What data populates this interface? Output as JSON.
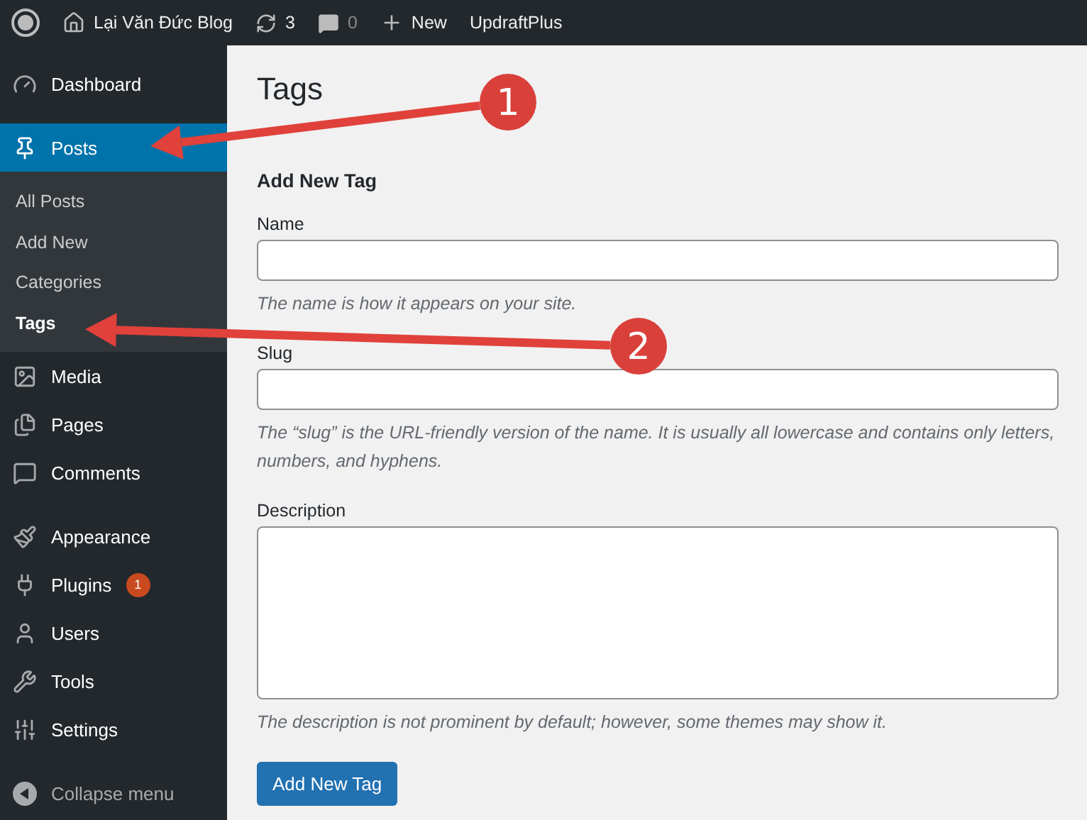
{
  "admin_bar": {
    "site_name": "Lại Văn Đức Blog",
    "updates_count": "3",
    "comments_count": "0",
    "new_label": "New",
    "plugin_link": "UpdraftPlus"
  },
  "sidebar": {
    "groups": [
      {
        "items": [
          {
            "label": "Dashboard",
            "selected": false
          }
        ]
      },
      {
        "items": [
          {
            "label": "Posts",
            "selected": true,
            "submenu": [
              {
                "label": "All Posts",
                "selected": false
              },
              {
                "label": "Add New",
                "selected": false
              },
              {
                "label": "Categories",
                "selected": false
              },
              {
                "label": "Tags",
                "selected": true
              }
            ]
          },
          {
            "label": "Media",
            "selected": false
          },
          {
            "label": "Pages",
            "selected": false
          },
          {
            "label": "Comments",
            "selected": false
          }
        ]
      },
      {
        "items": [
          {
            "label": "Appearance",
            "selected": false
          },
          {
            "label": "Plugins",
            "selected": false,
            "badge": "1"
          },
          {
            "label": "Users",
            "selected": false
          },
          {
            "label": "Tools",
            "selected": false
          },
          {
            "label": "Settings",
            "selected": false
          }
        ]
      }
    ],
    "collapse_label": "Collapse menu"
  },
  "page": {
    "title": "Tags",
    "form_title": "Add New Tag",
    "fields": [
      {
        "kind": "input",
        "label": "Name",
        "help": "The name is how it appears on your site."
      },
      {
        "kind": "input",
        "label": "Slug",
        "help": "The “slug” is the URL-friendly version of the name. It is usually all lowercase and contains only letters, numbers, and hyphens."
      },
      {
        "kind": "textarea",
        "label": "Description",
        "help": "The description is not prominent by default; however, some themes may show it."
      }
    ],
    "submit": "Add New Tag"
  },
  "annotations": [
    {
      "number": "1"
    },
    {
      "number": "2"
    }
  ]
}
